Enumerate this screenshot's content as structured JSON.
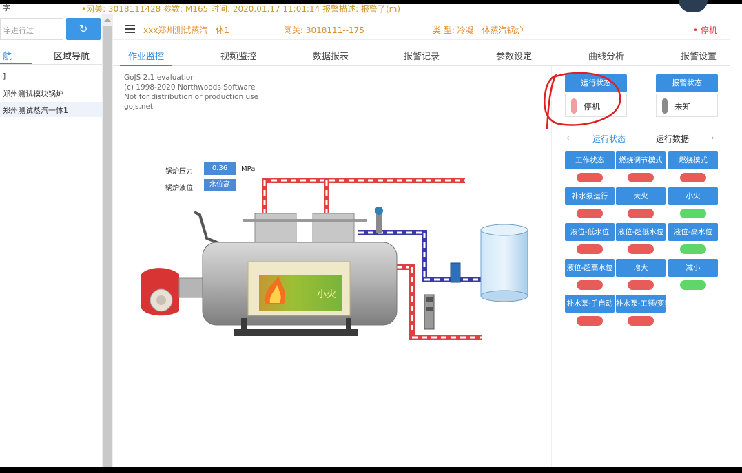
{
  "topbar": {
    "ticker": "•网关: 3018111428 参数: M165 时间: 2020.01.17 11:01:14 报警描述: 报警了(m)",
    "left_text": "字"
  },
  "sidebar": {
    "search_placeholder": "字进行过",
    "search_icon": "refresh-icon",
    "tabs": [
      "航",
      "区域导航"
    ],
    "tree": [
      "]",
      "郑州测试模块锅炉",
      "郑州测试蒸汽一体1"
    ]
  },
  "infobar": {
    "device": "xxx郑州测试蒸汽一体1",
    "gateway": "网关: 3018111--175",
    "type": "类 型: 冷凝一体蒸汽锅炉",
    "status": "• 停机"
  },
  "main_tabs": [
    "作业监控",
    "视频监控",
    "数据报表",
    "报警记录",
    "参数设定",
    "曲线分析",
    "报警设置"
  ],
  "watermark": [
    "GoJS 2.1 evaluation",
    "(c) 1998-2020 Northwoods Software",
    "Not for distribution or production use",
    "gojs.net"
  ],
  "gauges": {
    "pressure_label": "锅炉压力",
    "pressure_value": "0.36",
    "pressure_unit": "MPa",
    "level_label": "锅炉液位",
    "level_value": "水位高"
  },
  "boiler": {
    "flame_label": "小火"
  },
  "status": {
    "run_header": "运行状态",
    "run_value": "停机",
    "alarm_header": "报警状态",
    "alarm_value": "未知"
  },
  "sub_tabs": {
    "prev": "‹",
    "tab1": "运行状态",
    "tab2": "运行数据",
    "next": "›"
  },
  "indicators": [
    {
      "label": "工作状态",
      "color": "#e85b5b"
    },
    {
      "label": "燃烧调节模式",
      "color": "#e85b5b"
    },
    {
      "label": "燃烧模式",
      "color": "#e85b5b"
    },
    {
      "label": "补水泵运行",
      "color": "#e85b5b"
    },
    {
      "label": "大火",
      "color": "#e85b5b"
    },
    {
      "label": "小火",
      "color": "#5fd66a"
    },
    {
      "label": "液位-低水位",
      "color": "#e85b5b"
    },
    {
      "label": "液位-超低水位",
      "color": "#e85b5b"
    },
    {
      "label": "液位-高水位",
      "color": "#5fd66a"
    },
    {
      "label": "液位-超高水位",
      "color": "#e85b5b"
    },
    {
      "label": "增大",
      "color": "#e85b5b"
    },
    {
      "label": "减小",
      "color": "#5fd66a"
    },
    {
      "label": "补水泵-手自动",
      "color": "#e85b5b"
    },
    {
      "label": "补水泵-工频/变频",
      "color": "#e85b5b"
    }
  ],
  "colors": {
    "accent": "#2e8bde",
    "status_red": "#e85b5b",
    "status_green": "#5fd66a",
    "annotation": "#e02020"
  }
}
